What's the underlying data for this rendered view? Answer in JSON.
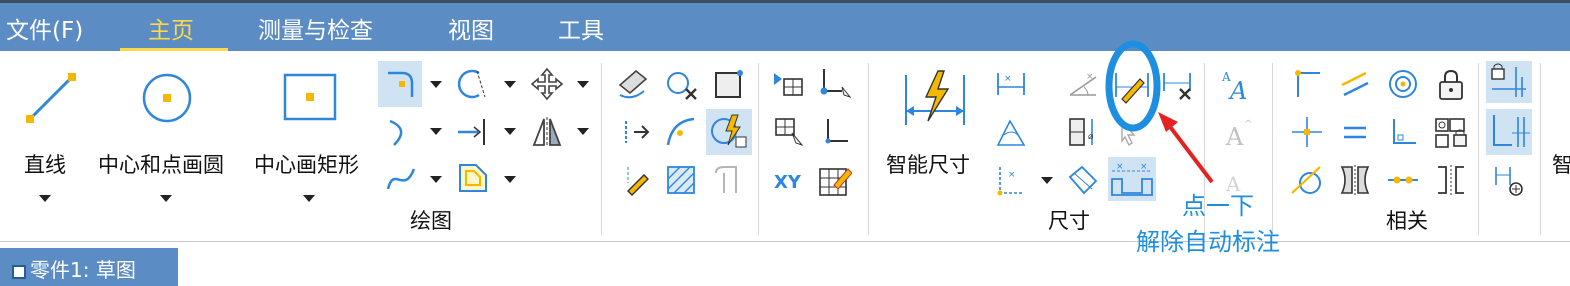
{
  "menu": {
    "file": "文件(F)",
    "home": "主页",
    "measure": "测量与检查",
    "view": "视图",
    "tools": "工具"
  },
  "draw": {
    "line": "直线",
    "center_circle": "中心和点画圆",
    "center_rect": "中心画矩形",
    "group_label": "绘图"
  },
  "dimension": {
    "smart": "智能尺寸",
    "group_label": "尺寸"
  },
  "relations": {
    "group_label": "相关"
  },
  "annotation": {
    "line1": "点一下",
    "line2": "解除自动标注"
  },
  "tabs": {
    "part": "零件1: 草图"
  },
  "colors": {
    "accent": "#5b8dc4",
    "active": "#ffd84a",
    "annotation": "#1e8fe0",
    "highlight": "#cfe3f3"
  }
}
